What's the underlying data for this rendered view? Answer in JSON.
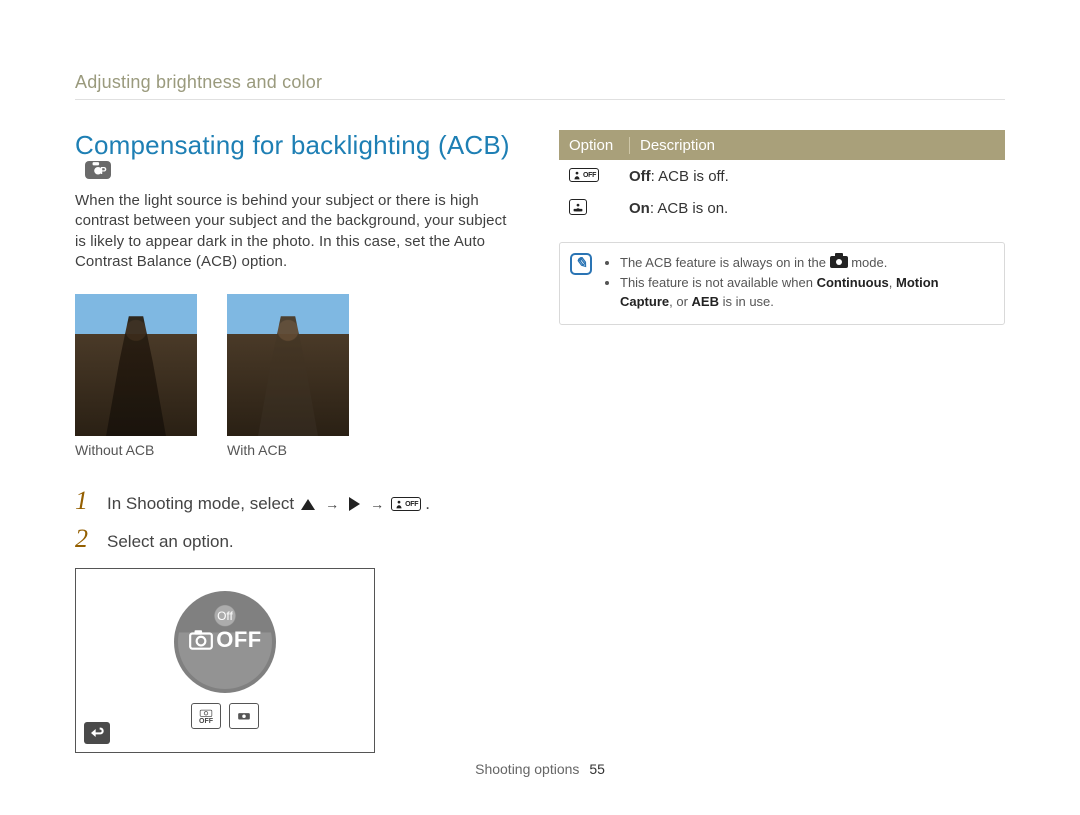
{
  "breadcrumb": "Adjusting brightness and color",
  "heading": "Compensating for backlighting (ACB)",
  "heading_mode_icon": "p-mode-icon",
  "intro": "When the light source is behind your subject or there is high contrast between your subject and the background, your subject is likely to appear dark in the photo. In this case, set the Auto Contrast Balance (ACB) option.",
  "thumbs": {
    "without": {
      "caption": "Without ACB"
    },
    "with": {
      "caption": "With ACB"
    }
  },
  "steps": [
    {
      "num": "1",
      "text_pre": "In Shooting mode, select ",
      "seq_end": "."
    },
    {
      "num": "2",
      "text": "Select an option."
    }
  ],
  "screen": {
    "label": "Off",
    "big_text": "OFF",
    "mini": [
      "OFF",
      ""
    ]
  },
  "option_table": {
    "headers": {
      "option": "Option",
      "description": "Description"
    },
    "rows": [
      {
        "icon": "acb-off",
        "name": "Off",
        "desc": ": ACB is off."
      },
      {
        "icon": "acb-on",
        "name": "On",
        "desc": ": ACB is on."
      }
    ]
  },
  "notes": {
    "line1_pre": "The ACB feature is always on in the ",
    "line1_post": " mode.",
    "line2_pre": "This feature is not available when ",
    "line2_b1": "Continuous",
    "line2_mid1": ", ",
    "line2_b2": "Motion Capture",
    "line2_mid2": ", or ",
    "line2_b3": "AEB",
    "line2_post": " is in use."
  },
  "footer": {
    "section": "Shooting options",
    "page": "55"
  },
  "chart_data": null
}
